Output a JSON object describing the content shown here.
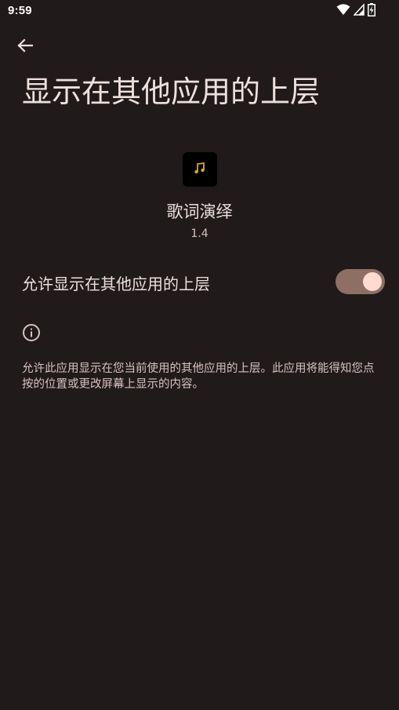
{
  "status_bar": {
    "time": "9:59",
    "icons": [
      "wifi-icon",
      "signal-icon",
      "battery-charging-icon"
    ]
  },
  "header": {
    "back_icon": "arrow-left-icon",
    "title": "显示在其他应用的上层"
  },
  "app": {
    "icon": "music-note-icon",
    "name": "歌词演绎",
    "version": "1.4"
  },
  "permission": {
    "label": "允许显示在其他应用的上层",
    "enabled": true
  },
  "info": {
    "icon": "info-icon",
    "text": "允许此应用显示在您当前使用的其他应用的上层。此应用将能得知您点按的位置或更改屏幕上显示的内容。"
  },
  "colors": {
    "background": "#201a1b",
    "switch_track": "#8e6f64",
    "switch_thumb": "#ffdbcf",
    "app_icon_accent": "#d4a33a"
  }
}
